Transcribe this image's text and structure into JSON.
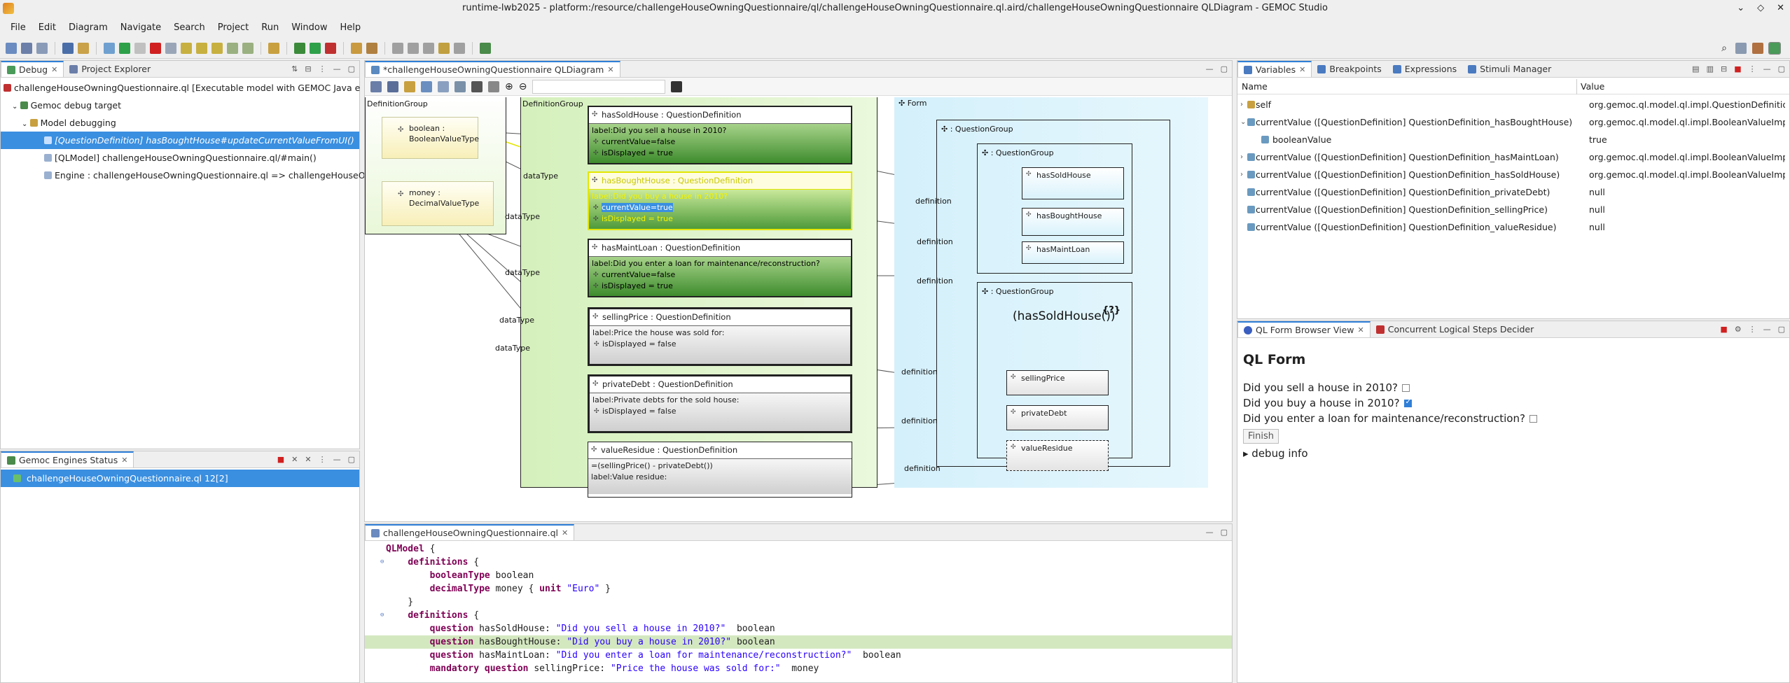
{
  "window": {
    "title": "runtime-lwb2025 - platform:/resource/challengeHouseOwningQuestionnaire/ql/challengeHouseOwningQuestionnaire.ql.aird/challengeHouseOwningQuestionnaire QLDiagram - GEMOC Studio"
  },
  "menu": [
    "File",
    "Edit",
    "Diagram",
    "Navigate",
    "Search",
    "Project",
    "Run",
    "Window",
    "Help"
  ],
  "debug_view": {
    "tabs": [
      "Debug",
      "Project Explorer"
    ],
    "tree": [
      "challengeHouseOwningQuestionnaire.ql [Executable model with GEMOC Java e",
      "Gemoc debug target",
      "Model debugging",
      "[QuestionDefinition] hasBoughtHouse#updateCurrentValueFromUI()",
      "[QLModel] challengeHouseOwningQuestionnaire.ql/#main()",
      "Engine : challengeHouseOwningQuestionnaire.ql => challengeHouseO"
    ]
  },
  "engines_view": {
    "tab": "Gemoc Engines Status",
    "row": "challengeHouseOwningQuestionnaire.ql  12[2]"
  },
  "diagram": {
    "tab": "*challengeHouseOwningQuestionnaire QLDiagram",
    "def_group_1": "DefinitionGroup",
    "def_group_2": "DefinitionGroup",
    "form": "Form",
    "types": [
      {
        "name": "boolean :",
        "type": "BooleanValueType"
      },
      {
        "name": "money :",
        "type": "DecimalValueType"
      }
    ],
    "questions": [
      {
        "header": "hasSoldHouse : QuestionDefinition",
        "label": "label:Did you sell a house in 2010?",
        "attrs": [
          "currentValue=false",
          "isDisplayed = true"
        ]
      },
      {
        "header": "hasBoughtHouse : QuestionDefinition",
        "label": "label:Did you buy a house in 2010?",
        "attrs": [
          "currentValue=true",
          "isDisplayed = true"
        ]
      },
      {
        "header": "hasMaintLoan : QuestionDefinition",
        "label": "label:Did you enter a loan for maintenance/reconstruction?",
        "attrs": [
          "currentValue=false",
          "isDisplayed = true"
        ]
      },
      {
        "header": "sellingPrice : QuestionDefinition",
        "label": "label:Price the house was sold for:",
        "attrs": [
          "isDisplayed = false"
        ]
      },
      {
        "header": "privateDebt : QuestionDefinition",
        "label": "label:Private debts for the sold house:",
        "attrs": [
          "isDisplayed = false"
        ]
      },
      {
        "header": "valueResidue : QuestionDefinition",
        "label": "=(sellingPrice() - privateDebt())",
        "label2": "label:Value residue:"
      }
    ],
    "qgroup_outer": ": QuestionGroup",
    "qgroup_1": ": QuestionGroup",
    "qgroup_2": ": QuestionGroup",
    "condition": "(hasSoldHouse())",
    "condition_badge": "{?}",
    "form_questions": [
      "hasSoldHouse",
      "hasBoughtHouse",
      "hasMaintLoan",
      "sellingPrice",
      "privateDebt",
      "valueResidue"
    ],
    "edge_datatype": "dataType",
    "edge_definition": "definition"
  },
  "editor": {
    "tab": "challengeHouseOwningQuestionnaire.ql",
    "lines": [
      {
        "t": [
          [
            "kw",
            "QLModel"
          ],
          [
            "",
            " {"
          ]
        ]
      },
      {
        "t": [
          [
            "",
            "    "
          ],
          [
            "kw",
            "definitions"
          ],
          [
            "",
            " {"
          ]
        ]
      },
      {
        "t": [
          [
            "",
            "        "
          ],
          [
            "kw",
            "booleanType"
          ],
          [
            "",
            " boolean"
          ]
        ]
      },
      {
        "t": [
          [
            "",
            "        "
          ],
          [
            "kw",
            "decimalType"
          ],
          [
            "",
            " money { "
          ],
          [
            "kw",
            "unit"
          ],
          [
            "",
            " "
          ],
          [
            "str",
            "\"Euro\""
          ],
          [
            "",
            " }"
          ]
        ]
      },
      {
        "t": [
          [
            "",
            "    }"
          ]
        ]
      },
      {
        "t": [
          [
            "",
            "    "
          ],
          [
            "kw",
            "definitions"
          ],
          [
            "",
            " {"
          ]
        ]
      },
      {
        "t": [
          [
            "",
            "        "
          ],
          [
            "kw",
            "question"
          ],
          [
            "",
            " hasSoldHouse: "
          ],
          [
            "str",
            "\"Did you sell a house in 2010?\""
          ],
          [
            "",
            "  boolean"
          ]
        ]
      },
      {
        "t": [
          [
            "",
            "        "
          ],
          [
            "kw",
            "question"
          ],
          [
            "",
            " hasBoughtHouse: "
          ],
          [
            "str",
            "\"Did you buy a house in 2010?\""
          ],
          [
            "",
            " boolean"
          ]
        ]
      },
      {
        "t": [
          [
            "",
            "        "
          ],
          [
            "kw",
            "question"
          ],
          [
            "",
            " hasMaintLoan: "
          ],
          [
            "str",
            "\"Did you enter a loan for maintenance/reconstruction?\""
          ],
          [
            "",
            "  boolean"
          ]
        ]
      },
      {
        "t": [
          [
            "",
            "        "
          ],
          [
            "kw",
            "mandatory question"
          ],
          [
            "",
            " sellingPrice: "
          ],
          [
            "str",
            "\"Price the house was sold for:\""
          ],
          [
            "",
            "  money"
          ]
        ]
      }
    ]
  },
  "variables": {
    "tabs": [
      "Variables",
      "Breakpoints",
      "Expressions",
      "Stimuli Manager"
    ],
    "col_name": "Name",
    "col_value": "Value",
    "rows": [
      {
        "n": "self",
        "v": "org.gemoc.ql.model.ql.impl.QuestionDefinition"
      },
      {
        "n": "currentValue ([QuestionDefinition] QuestionDefinition_hasBoughtHouse)",
        "v": "org.gemoc.ql.model.ql.impl.BooleanValueImpl"
      },
      {
        "n": "booleanValue",
        "v": "true"
      },
      {
        "n": "currentValue ([QuestionDefinition] QuestionDefinition_hasMaintLoan)",
        "v": "org.gemoc.ql.model.ql.impl.BooleanValueImpl"
      },
      {
        "n": "currentValue ([QuestionDefinition] QuestionDefinition_hasSoldHouse)",
        "v": "org.gemoc.ql.model.ql.impl.BooleanValueImpl"
      },
      {
        "n": "currentValue ([QuestionDefinition] QuestionDefinition_privateDebt)",
        "v": "null"
      },
      {
        "n": "currentValue ([QuestionDefinition] QuestionDefinition_sellingPrice)",
        "v": "null"
      },
      {
        "n": "currentValue ([QuestionDefinition] QuestionDefinition_valueResidue)",
        "v": "null"
      }
    ]
  },
  "ql_view": {
    "tabs": [
      "QL Form Browser View",
      "Concurrent Logical Steps Decider"
    ],
    "title": "QL Form",
    "questions": [
      {
        "text": "Did you sell a house in 2010?",
        "checked": false
      },
      {
        "text": "Did you buy a house in 2010?",
        "checked": true
      },
      {
        "text": "Did you enter a loan for maintenance/reconstruction?",
        "checked": false
      }
    ],
    "finish": "Finish",
    "debug_info": "▸ debug info"
  }
}
